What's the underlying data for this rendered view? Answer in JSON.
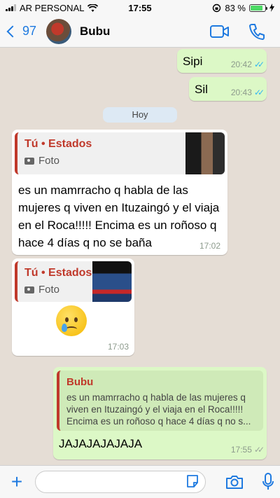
{
  "status_bar": {
    "carrier": "AR PERSONAL",
    "time": "17:55",
    "battery": "83 %",
    "battery_level": 0.83
  },
  "nav": {
    "back_count": "97",
    "contact_name": "Bubu"
  },
  "messages": {
    "m1": {
      "text": "Sipi",
      "time": "20:42"
    },
    "m2": {
      "text": "Sil",
      "time": "20:43"
    },
    "date_separator": "Hoy",
    "m3": {
      "quote_author": "Tú • Estados",
      "quote_media": "Foto",
      "text": "es un mamrracho q habla de las mujeres q viven en Ituzaingó y el viaja en el Roca!!!!! Encima es un roñoso q hace 4 días q no se baña",
      "time": "17:02"
    },
    "m4": {
      "quote_author": "Tú • Estados",
      "quote_media": "Foto",
      "time": "17:03"
    },
    "m5": {
      "quote_author": "Bubu",
      "quote_text": "es un mamrracho q habla de las mujeres q viven en Ituzaingó y el viaja en el Roca!!!!! Encima es un roñoso q hace 4 días q no s...",
      "text": "JAJAJAJAJAJA",
      "time": "17:55"
    }
  },
  "input": {
    "placeholder": ""
  },
  "colors": {
    "accent": "#1f7ae0",
    "outgoing_bubble": "#dcf8c6",
    "incoming_bubble": "#ffffff",
    "quote_author": "#c0392b",
    "read_ticks": "#34b7f1"
  },
  "icons": [
    "back-chevron-icon",
    "video-call-icon",
    "phone-icon",
    "camera-icon",
    "plus-icon",
    "sticker-icon",
    "microphone-icon"
  ]
}
